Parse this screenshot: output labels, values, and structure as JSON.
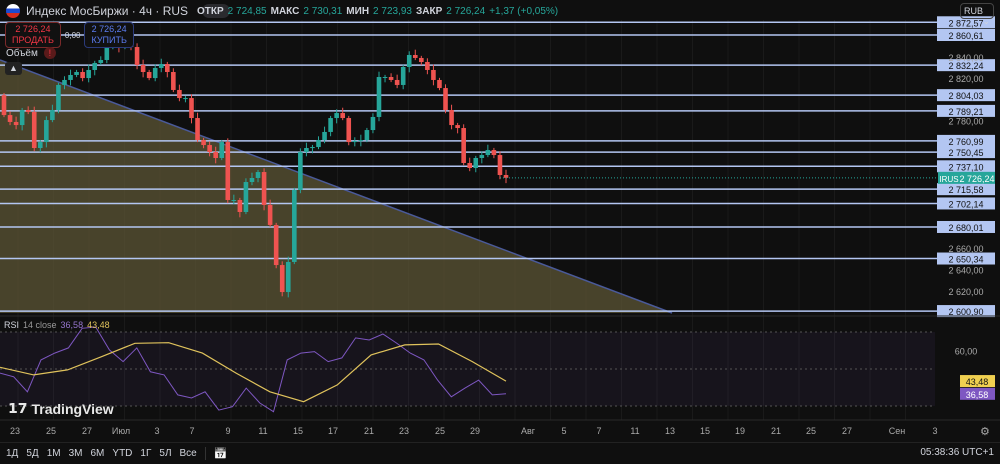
{
  "header": {
    "title": "Индекс МосБиржи · 4ч · RUS",
    "open_label": "ОТКР",
    "open": "2 724,85",
    "high_label": "МАКС",
    "high": "2 730,31",
    "low_label": "МИН",
    "low": "2 723,93",
    "close_label": "ЗАКР",
    "close": "2 726,24",
    "change": "+1,37 (+0,05%)"
  },
  "trade": {
    "sell_price": "2 726,24",
    "sell_label": "ПРОДАТЬ",
    "spread": "0,00",
    "buy_price": "2 726,24",
    "buy_label": "КУПИТЬ"
  },
  "volume_label": "Объём",
  "currency": "RUB",
  "rsi": {
    "label": "RSI",
    "params": "14 close",
    "value": "36,58",
    "ma_value": "43,48",
    "level_label": "60,00"
  },
  "symbol_tag": "IRUS",
  "last_price": "2 726,24",
  "logo_text": "TradingView",
  "colors": {
    "up": "#26a69a",
    "down": "#ef5350",
    "level": "#b3c6f2",
    "rsi": "#7e57c2",
    "rsi_ma": "#e0c35c",
    "zone": "#5c5636"
  },
  "chart_data": {
    "type": "candlestick",
    "closes": [
      2785.3,
      2778.8,
      2775.9,
      2790.0,
      2788.2,
      2754.3,
      2759.9,
      2780.6,
      2790.0,
      2813.6,
      2818.3,
      2823.0,
      2825.8,
      2820.1,
      2827.7,
      2834.3,
      2837.1,
      2851.2,
      2860.6,
      2849.3,
      2851.2,
      2849.3,
      2832.4,
      2825.8,
      2820.1,
      2829.6,
      2833.3,
      2825.8,
      2808.9,
      2801.3,
      2801.3,
      2782.5,
      2761.8,
      2757.1,
      2750.5,
      2744.9,
      2759.9,
      2705.4,
      2705.4,
      2694.1,
      2722.3,
      2726.1,
      2731.7,
      2700.7,
      2681.9,
      2644.2,
      2618.8,
      2647.1,
      2714.8,
      2750.5,
      2754.3,
      2755.2,
      2761.8,
      2769.4,
      2782.5,
      2787.2,
      2782.5,
      2759.9,
      2760.9,
      2761.8,
      2771.2,
      2783.5,
      2821.1,
      2821.1,
      2818.3,
      2813.6,
      2830.5,
      2841.8,
      2839.0,
      2835.2,
      2827.7,
      2818.3,
      2810.7,
      2790.0,
      2775.9,
      2773.1,
      2740.2,
      2735.5,
      2744.9,
      2747.7,
      2752.4,
      2747.7,
      2728.9,
      2726.24
    ],
    "first_open": 2804.0,
    "levels": [
      "2 872,57",
      "2 860,61",
      "2 832,24",
      "2 804,03",
      "2 789,21",
      "2 760,99",
      "2 750,45",
      "2 737,10",
      "2 715,58",
      "2 702,14",
      "2 680,01",
      "2 650,34",
      "2 600,90"
    ],
    "price_ticks": [
      "2 840,00",
      "2 820,00",
      "2 780,00",
      "2 660,00",
      "2 640,00",
      "2 620,00"
    ],
    "date_ticks": [
      "23",
      "25",
      "27",
      "Июл",
      "3",
      "7",
      "9",
      "11",
      "15",
      "17",
      "21",
      "23",
      "25",
      "29",
      "Авг",
      "5",
      "7",
      "11",
      "13",
      "15",
      "19",
      "21",
      "25",
      "27",
      "Сен",
      "3"
    ],
    "rsi_values": [
      47.8,
      45.8,
      37.7,
      54.9,
      58.6,
      61.4,
      72,
      72.7,
      60.3,
      54,
      61.4,
      48.5,
      46.8,
      36,
      34.3,
      37.7,
      27.8,
      29.6,
      39.7,
      31.6,
      26.9,
      54.9,
      58.6,
      59.4,
      54,
      56,
      66.8,
      65.7,
      68.9,
      64,
      58.6,
      54.9,
      44,
      35,
      39.7,
      44,
      36,
      36.58
    ],
    "rsi_ma_values": [
      50.9,
      46.8,
      49.5,
      56.6,
      63.9,
      64.2,
      58.6,
      47.8,
      37.7,
      32.3,
      41.4,
      57.6,
      63,
      63.5,
      54,
      43.48
    ],
    "rsi_range": [
      30,
      70
    ]
  },
  "toolbar": {
    "ranges": [
      "1Д",
      "5Д",
      "1М",
      "3М",
      "6М",
      "YTD",
      "1Г",
      "5Л",
      "Все"
    ],
    "time": "05:38:36 UTC+1"
  }
}
